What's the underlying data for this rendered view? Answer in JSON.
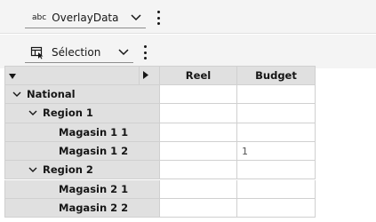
{
  "toolbar1": {
    "type_icon": "abc",
    "dropdown_value": "OverlayData",
    "more_icon": "overflow-menu-vertical-icon"
  },
  "toolbar2": {
    "icon": "table-selection-icon",
    "dropdown_value": "Sélection",
    "more_icon": "overflow-menu-vertical-icon"
  },
  "grid": {
    "columns": [
      "Reel",
      "Budget"
    ],
    "rows": [
      {
        "label": "National",
        "level": 0,
        "expandable": true,
        "reel": "",
        "budget": ""
      },
      {
        "label": "Region 1",
        "level": 1,
        "expandable": true,
        "reel": "",
        "budget": ""
      },
      {
        "label": "Magasin 1 1",
        "level": 2,
        "expandable": false,
        "reel": "",
        "budget": ""
      },
      {
        "label": "Magasin 1 2",
        "level": 2,
        "expandable": false,
        "reel": "",
        "budget": "1"
      },
      {
        "label": "Region 2",
        "level": 1,
        "expandable": true,
        "reel": "",
        "budget": ""
      },
      {
        "label": "Magasin 2 1",
        "level": 2,
        "expandable": false,
        "reel": "",
        "budget": ""
      },
      {
        "label": "Magasin 2 2",
        "level": 2,
        "expandable": false,
        "reel": "",
        "budget": ""
      }
    ]
  }
}
